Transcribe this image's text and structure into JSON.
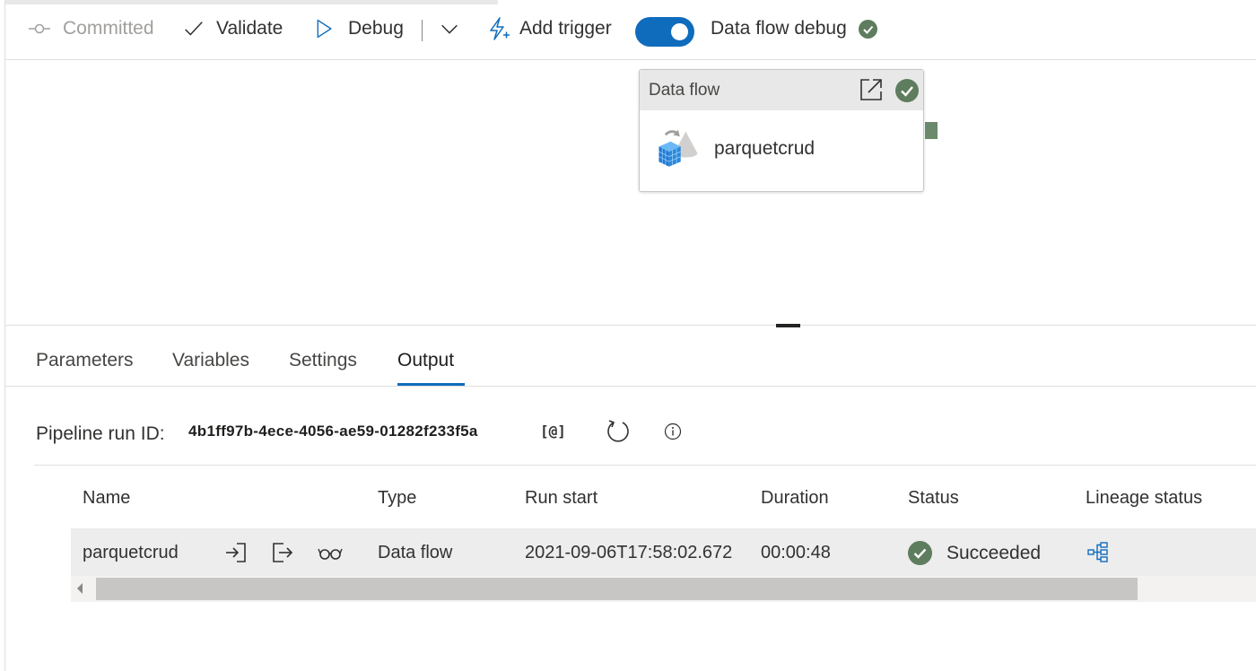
{
  "toolbar": {
    "committed_label": "Committed",
    "validate_label": "Validate",
    "debug_label": "Debug",
    "add_trigger_label": "Add trigger",
    "data_flow_debug_label": "Data flow debug",
    "data_flow_debug_on": true
  },
  "canvas": {
    "node": {
      "type_label": "Data flow",
      "name": "parquetcrud",
      "status": "succeeded"
    }
  },
  "panel": {
    "tabs": [
      {
        "label": "Parameters",
        "active": false
      },
      {
        "label": "Variables",
        "active": false
      },
      {
        "label": "Settings",
        "active": false
      },
      {
        "label": "Output",
        "active": true
      }
    ],
    "run_id_label": "Pipeline run ID:",
    "run_id_value": "4b1ff97b-4ece-4056-ae59-01282f233f5a",
    "copy_label": "[@]"
  },
  "table": {
    "headers": {
      "name": "Name",
      "type": "Type",
      "run_start": "Run start",
      "duration": "Duration",
      "status": "Status",
      "lineage_status": "Lineage status"
    },
    "rows": [
      {
        "name": "parquetcrud",
        "type": "Data flow",
        "run_start": "2021-09-06T17:58:02.672",
        "duration": "00:00:48",
        "status": "Succeeded"
      }
    ]
  },
  "colors": {
    "accent": "#0f6cbd",
    "success": "#5e7d5e",
    "row_bg": "#ededed"
  },
  "icons": {
    "committed": "commit-icon",
    "validate": "checkmark-icon",
    "debug": "play-icon",
    "dropdown": "chevron-down-icon",
    "trigger": "lightning-icon",
    "open": "open-external-icon",
    "refresh": "refresh-icon",
    "info": "info-icon",
    "input": "input-icon",
    "output": "output-icon",
    "details": "glasses-icon",
    "lineage": "lineage-icon"
  }
}
